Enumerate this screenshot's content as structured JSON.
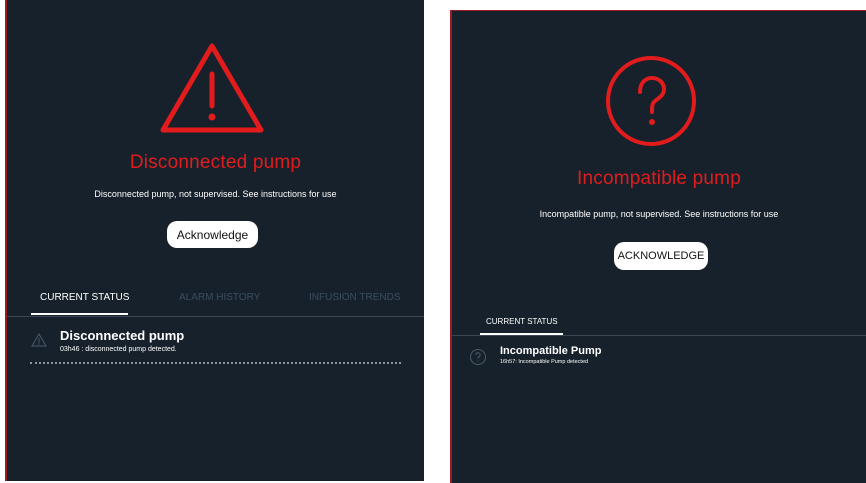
{
  "left_panel": {
    "icon": "warning-triangle-icon",
    "alarm_title": "Disconnected pump",
    "alarm_message": "Disconnected pump, not supervised. See instructions for use",
    "ack_label": "Acknowledge",
    "tabs": [
      {
        "label": "CURRENT STATUS",
        "active": true
      },
      {
        "label": "ALARM HISTORY",
        "active": false
      },
      {
        "label": "INFUSION TRENDS",
        "active": false
      }
    ],
    "status": {
      "icon": "warning-triangle-icon",
      "title": "Disconnected pump",
      "detail": "03h46 : disconnected pump detected."
    }
  },
  "right_panel": {
    "icon": "question-circle-icon",
    "alarm_title": "Incompatible pump",
    "alarm_message": "Incompatible pump, not supervised. See instructions for use",
    "ack_label": "ACKNOWLEDGE",
    "tabs": [
      {
        "label": "CURRENT STATUS",
        "active": true
      }
    ],
    "status": {
      "icon": "question-circle-icon",
      "title": "Incompatible Pump",
      "detail": "16h57: Incompatible Pump detected"
    }
  },
  "colors": {
    "background": "#17212b",
    "alarm_red": "#e21c1c",
    "text": "#ffffff",
    "inactive_tab": "#3a4c60"
  }
}
